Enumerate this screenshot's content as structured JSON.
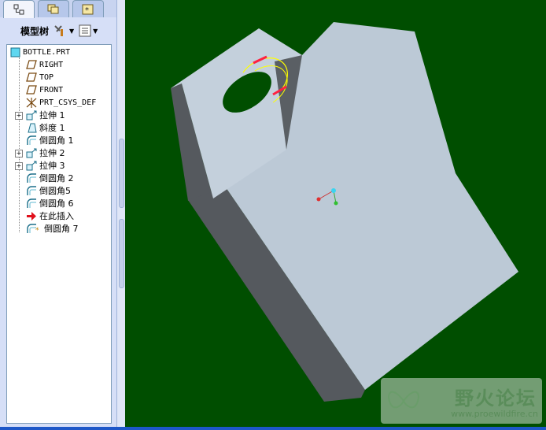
{
  "panel": {
    "toolbar_label": "模型树",
    "tabs": [
      {
        "icon": "model-tree-icon"
      },
      {
        "icon": "layers-icon"
      },
      {
        "icon": "favorites-icon"
      }
    ]
  },
  "tree": {
    "root": "BOTTLE.PRT",
    "items": [
      {
        "label": "RIGHT",
        "icon": "datum-plane-icon"
      },
      {
        "label": "TOP",
        "icon": "datum-plane-icon"
      },
      {
        "label": "FRONT",
        "icon": "datum-plane-icon"
      },
      {
        "label": "PRT_CSYS_DEF",
        "icon": "csys-icon"
      },
      {
        "label": "拉伸 1",
        "icon": "extrude-icon",
        "expandable": true
      },
      {
        "label": "斜度 1",
        "icon": "draft-icon"
      },
      {
        "label": "倒圆角 1",
        "icon": "round-icon"
      },
      {
        "label": "拉伸 2",
        "icon": "extrude-icon",
        "expandable": true
      },
      {
        "label": "拉伸 3",
        "icon": "extrude-icon",
        "expandable": true
      },
      {
        "label": "倒圆角 2",
        "icon": "round-icon"
      },
      {
        "label": "倒圆角5",
        "icon": "round-icon"
      },
      {
        "label": "倒圆角 6",
        "icon": "round-icon"
      },
      {
        "label": "在此插入",
        "icon": "insert-here-arrow-icon"
      },
      {
        "label": "倒圆角 7",
        "icon": "round-icon"
      }
    ]
  },
  "watermark": {
    "text": "野火论坛",
    "url": "www.proewildfire.cn"
  },
  "colors": {
    "viewport_bg": "#004e00",
    "model_face": "#bcc9d6",
    "model_side": "#55595e",
    "highlight_edge": "#ffff00",
    "datum_red": "#ff2040"
  }
}
